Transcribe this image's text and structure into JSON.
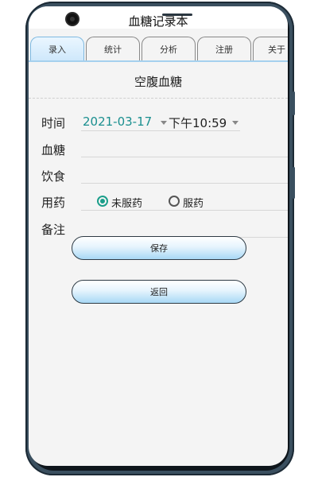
{
  "app": {
    "title": "血糖记录本"
  },
  "tabs": [
    {
      "label": "录入",
      "active": true
    },
    {
      "label": "统计",
      "active": false
    },
    {
      "label": "分析",
      "active": false
    },
    {
      "label": "注册",
      "active": false
    },
    {
      "label": "关于",
      "active": false
    }
  ],
  "form": {
    "section_title": "空腹血糖",
    "time_label": "时间",
    "date_value": "2021-03-17",
    "time_value": "下午10:59",
    "glucose_label": "血糖",
    "diet_label": "饮食",
    "medication_label": "用药",
    "medication_options": [
      "未服药",
      "服药"
    ],
    "medication_selected": "未服药",
    "notes_label": "备注"
  },
  "buttons": {
    "save": "保存",
    "back": "返回"
  },
  "colors": {
    "accent": "#1a9e8a",
    "date_text": "#1a8f8f",
    "button_blue": "#a8d8f5"
  }
}
